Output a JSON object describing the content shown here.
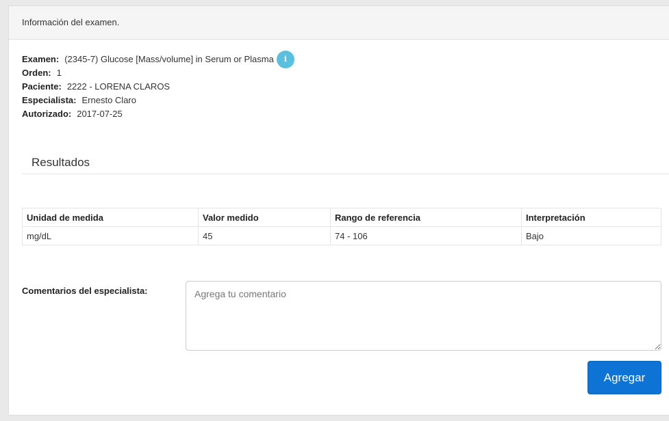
{
  "panel": {
    "heading": "Información del examen."
  },
  "exam_info": {
    "exam_label": "Examen:",
    "exam_value": "(2345-7) Glucose [Mass/volume] in Serum or Plasma",
    "info_icon": "info-circle-icon",
    "order_label": "Orden:",
    "order_value": "1",
    "patient_label": "Paciente:",
    "patient_value": "2222 - LORENA CLAROS",
    "specialist_label": "Especialista:",
    "specialist_value": "Ernesto Claro",
    "authorized_label": "Autorizado:",
    "authorized_value": "2017-07-25"
  },
  "results": {
    "title": "Resultados",
    "columns": [
      "Unidad de medida",
      "Valor medido",
      "Rango de referencia",
      "Interpretación"
    ],
    "rows": [
      [
        "mg/dL",
        "45",
        "74 - 106",
        "Bajo"
      ]
    ]
  },
  "comments": {
    "label": "Comentarios del especialista:",
    "placeholder": "Agrega tu comentario",
    "value": ""
  },
  "actions": {
    "add_label": "Agregar"
  },
  "colors": {
    "info_icon": "#5bc0de",
    "primary_button": "#0d73d5"
  }
}
